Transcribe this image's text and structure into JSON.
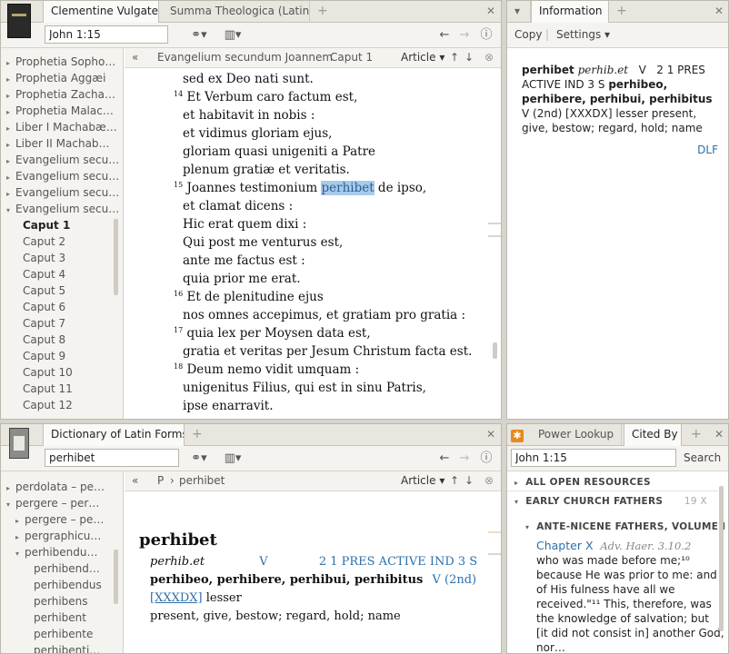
{
  "bible_pane": {
    "tabs": [
      {
        "label": "Clementine Vulgate"
      },
      {
        "label": "Summa Theologica (Latin)"
      }
    ],
    "reference": "John 1:15",
    "nav": {
      "breadcrumb_book": "Evangelium secundum Joannem",
      "breadcrumb_chapter": "Caput 1",
      "article_label": "Article"
    },
    "sidebar_items": [
      {
        "label": "Prophetia Sopho…",
        "arrow": "▸",
        "indent": 0,
        "bold": false
      },
      {
        "label": "Prophetia Aggæi",
        "arrow": "▸",
        "indent": 0,
        "bold": false
      },
      {
        "label": "Prophetia Zacha…",
        "arrow": "▸",
        "indent": 0,
        "bold": false
      },
      {
        "label": "Prophetia Malac…",
        "arrow": "▸",
        "indent": 0,
        "bold": false
      },
      {
        "label": "Liber I Machabæ…",
        "arrow": "▸",
        "indent": 0,
        "bold": false
      },
      {
        "label": "Liber II Machab…",
        "arrow": "▸",
        "indent": 0,
        "bold": false
      },
      {
        "label": "Evangelium secu…",
        "arrow": "▸",
        "indent": 0,
        "bold": false
      },
      {
        "label": "Evangelium secu…",
        "arrow": "▸",
        "indent": 0,
        "bold": false
      },
      {
        "label": "Evangelium secu…",
        "arrow": "▸",
        "indent": 0,
        "bold": false
      },
      {
        "label": "Evangelium secu…",
        "arrow": "▾",
        "indent": 0,
        "bold": false
      },
      {
        "label": "Caput 1",
        "arrow": "",
        "indent": 1,
        "bold": true
      },
      {
        "label": "Caput 2",
        "arrow": "",
        "indent": 1,
        "bold": false
      },
      {
        "label": "Caput 3",
        "arrow": "",
        "indent": 1,
        "bold": false
      },
      {
        "label": "Caput 4",
        "arrow": "",
        "indent": 1,
        "bold": false
      },
      {
        "label": "Caput 5",
        "arrow": "",
        "indent": 1,
        "bold": false
      },
      {
        "label": "Caput 6",
        "arrow": "",
        "indent": 1,
        "bold": false
      },
      {
        "label": "Caput 7",
        "arrow": "",
        "indent": 1,
        "bold": false
      },
      {
        "label": "Caput 8",
        "arrow": "",
        "indent": 1,
        "bold": false
      },
      {
        "label": "Caput 9",
        "arrow": "",
        "indent": 1,
        "bold": false
      },
      {
        "label": "Caput 10",
        "arrow": "",
        "indent": 1,
        "bold": false
      },
      {
        "label": "Caput 11",
        "arrow": "",
        "indent": 1,
        "bold": false
      },
      {
        "label": "Caput 12",
        "arrow": "",
        "indent": 1,
        "bold": false
      }
    ],
    "text_lines": [
      {
        "verse": "",
        "pre": "sed ex Deo nati sunt.",
        "hl": "",
        "post": ""
      },
      {
        "verse": "14",
        "pre": "Et Verbum caro factum est,",
        "hl": "",
        "post": ""
      },
      {
        "verse": "",
        "pre": "et habitavit in nobis :",
        "hl": "",
        "post": ""
      },
      {
        "verse": "",
        "pre": "et vidimus gloriam ejus,",
        "hl": "",
        "post": ""
      },
      {
        "verse": "",
        "pre": "gloriam quasi unigeniti a Patre",
        "hl": "",
        "post": ""
      },
      {
        "verse": "",
        "pre": "plenum gratiæ et veritatis.",
        "hl": "",
        "post": ""
      },
      {
        "verse": "15",
        "pre": "Joannes testimonium ",
        "hl": "perhibet",
        "post": " de ipso,"
      },
      {
        "verse": "",
        "pre": "et clamat dicens :",
        "hl": "",
        "post": ""
      },
      {
        "verse": "",
        "pre": "Hic erat quem dixi :",
        "hl": "",
        "post": ""
      },
      {
        "verse": "",
        "pre": "Qui post me venturus est,",
        "hl": "",
        "post": ""
      },
      {
        "verse": "",
        "pre": "ante me factus est :",
        "hl": "",
        "post": ""
      },
      {
        "verse": "",
        "pre": "quia prior me erat.",
        "hl": "",
        "post": ""
      },
      {
        "verse": "16",
        "pre": "Et de plenitudine ejus",
        "hl": "",
        "post": ""
      },
      {
        "verse": "",
        "pre": "nos omnes accepimus, et gratiam pro gratia :",
        "hl": "",
        "post": ""
      },
      {
        "verse": "17",
        "pre": "quia lex per Moysen data est,",
        "hl": "",
        "post": ""
      },
      {
        "verse": "",
        "pre": "gratia et veritas per Jesum Christum facta est.",
        "hl": "",
        "post": ""
      },
      {
        "verse": "18",
        "pre": "Deum nemo vidit umquam :",
        "hl": "",
        "post": ""
      },
      {
        "verse": "",
        "pre": "unigenitus Filius, qui est in sinu Patris,",
        "hl": "",
        "post": ""
      },
      {
        "verse": "",
        "pre": "ipse enarravit.",
        "hl": "",
        "post": ""
      }
    ]
  },
  "info_pane": {
    "tab": "Information",
    "copy_label": "Copy",
    "settings_label": "Settings",
    "word": "perhibet",
    "form": "perhib.et",
    "pos": "V",
    "parse": "2 1 PRES ACTIVE IND 3 S",
    "principal_parts": "perhibeo, perhibere, perhibui, perhibitus",
    "conj": "V (2nd) [XXXDX]",
    "definition": "lesser present, give, bestow; regard, hold; name",
    "source": "DLF"
  },
  "dict_pane": {
    "tab": "Dictionary of Latin Forms",
    "search": "perhibet",
    "nav": {
      "breadcrumb_letter": "P",
      "breadcrumb_word": "perhibet",
      "article_label": "Article"
    },
    "sidebar_items": [
      {
        "label": "perdolata – pe…",
        "arrow": "▸",
        "indent": 0
      },
      {
        "label": "pergere – per…",
        "arrow": "▾",
        "indent": 0
      },
      {
        "label": "pergere – pe…",
        "arrow": "▸",
        "indent": 1
      },
      {
        "label": "pergraphicu…",
        "arrow": "▸",
        "indent": 1
      },
      {
        "label": "perhibendu…",
        "arrow": "▾",
        "indent": 1
      },
      {
        "label": "perhibend…",
        "arrow": "",
        "indent": 2
      },
      {
        "label": "perhibendus",
        "arrow": "",
        "indent": 2
      },
      {
        "label": "perhibens",
        "arrow": "",
        "indent": 2
      },
      {
        "label": "perhibent",
        "arrow": "",
        "indent": 2
      },
      {
        "label": "perhibente",
        "arrow": "",
        "indent": 2
      },
      {
        "label": "perhibenti…",
        "arrow": "",
        "indent": 2
      }
    ],
    "headword": "perhibet",
    "form": "perhib.et",
    "pos": "V",
    "parse": "2 1 PRES ACTIVE IND 3 S",
    "principal_parts": "perhibeo, perhibere, perhibui, perhibitus",
    "conj": "V (2nd)",
    "code": "[XXXDX]",
    "lesser": " lesser",
    "definition": "present, give, bestow; regard, hold; name"
  },
  "cited_pane": {
    "tabs": [
      {
        "label": "Power Lookup"
      },
      {
        "label": "Cited By"
      }
    ],
    "reference": "John 1:15",
    "search_label": "Search",
    "all_open": "ALL OPEN RESOURCES",
    "early": "EARLY CHURCH FATHERS",
    "early_count": "19 X",
    "volume": "ANTE-NICENE FATHERS, VOLUME I",
    "chapter": "Chapter X",
    "chapter_ref": "Adv. Haer. 3.10.2",
    "quote": [
      "who was made before me;¹⁰",
      "because He was prior to me: and",
      "of His fulness have all we",
      "received.\"¹¹ This, therefore, was",
      "the knowledge of salvation; but",
      "[it did not consist in] another God,",
      "nor…"
    ]
  },
  "colors": {
    "accent": "#2e6fa8",
    "highlight": "#a8cbe9",
    "orange": "#e8891c"
  }
}
